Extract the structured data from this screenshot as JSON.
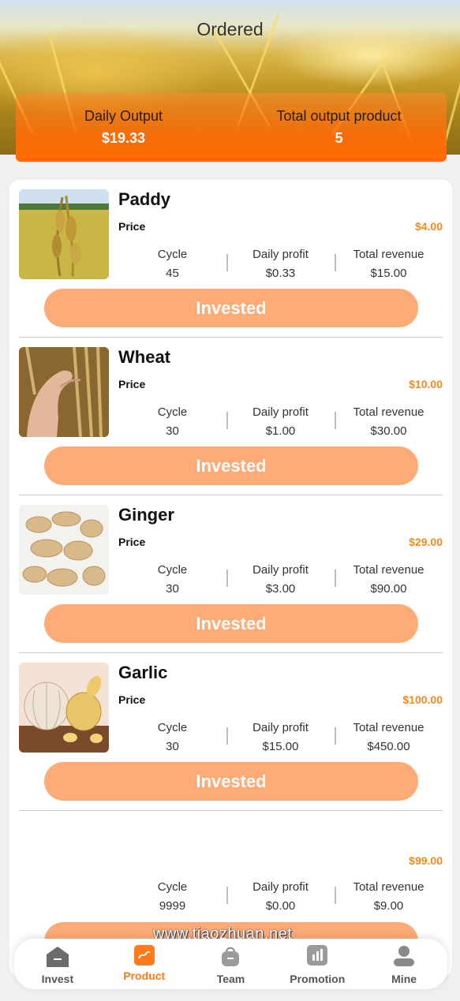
{
  "header": {
    "title": "Ordered",
    "daily_output_label": "Daily Output",
    "daily_output_value": "$19.33",
    "total_output_label": "Total output product",
    "total_output_value": "5"
  },
  "products": [
    {
      "name": "Paddy",
      "price_label": "Price",
      "price": "$4.00",
      "cycle_label": "Cycle",
      "cycle": "45",
      "daily_label": "Daily profit",
      "daily": "$0.33",
      "total_label": "Total revenue",
      "total": "$15.00",
      "button": "Invested",
      "image": "paddy-field"
    },
    {
      "name": "Wheat",
      "price_label": "Price",
      "price": "$10.00",
      "cycle_label": "Cycle",
      "cycle": "30",
      "daily_label": "Daily profit",
      "daily": "$1.00",
      "total_label": "Total revenue",
      "total": "$30.00",
      "button": "Invested",
      "image": "wheat-in-hand"
    },
    {
      "name": "Ginger",
      "price_label": "Price",
      "price": "$29.00",
      "cycle_label": "Cycle",
      "cycle": "30",
      "daily_label": "Daily profit",
      "daily": "$3.00",
      "total_label": "Total revenue",
      "total": "$90.00",
      "button": "Invested",
      "image": "ginger-roots"
    },
    {
      "name": "Garlic",
      "price_label": "Price",
      "price": "$100.00",
      "cycle_label": "Cycle",
      "cycle": "30",
      "daily_label": "Daily profit",
      "daily": "$15.00",
      "total_label": "Total revenue",
      "total": "$450.00",
      "button": "Invested",
      "image": "garlic-bulbs"
    },
    {
      "name": "",
      "price_label": "",
      "price": "$99.00",
      "cycle_label": "Cycle",
      "cycle": "9999",
      "daily_label": "Daily profit",
      "daily": "$0.00",
      "total_label": "Total revenue",
      "total": "$9.00",
      "button": "",
      "image": ""
    }
  ],
  "nav": [
    {
      "label": "Invest",
      "icon": "home-icon"
    },
    {
      "label": "Product",
      "icon": "chart-icon",
      "active": true
    },
    {
      "label": "Team",
      "icon": "bag-icon"
    },
    {
      "label": "Promotion",
      "icon": "bar-chart-icon"
    },
    {
      "label": "Mine",
      "icon": "user-icon"
    }
  ],
  "watermark": "www.tiaozhuan.net",
  "colors": {
    "accent": "#ff7a1a",
    "button": "#ffab78",
    "price": "#f28a1c"
  }
}
